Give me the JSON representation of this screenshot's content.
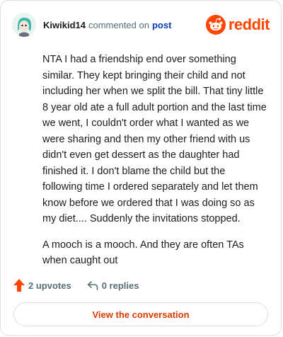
{
  "header": {
    "username": "Kiwikid14",
    "commented_text": "commented on",
    "post_link": "post",
    "brand": "reddit"
  },
  "comment": {
    "paragraphs": [
      "NTA I had a friendship end over something similar. They kept bringing their child and not including her when we split the bill. That tiny little 8 year old ate a full adult portion and the last time we went, I couldn't order what I wanted as we were sharing and then my other friend with us didn't even get dessert as the daughter had finished it. I don't blame the child but the following time I ordered separately and let them know before we ordered that I was doing so as my diet.... Suddenly the invitations stopped.",
      "A mooch is a mooch. And they are often TAs when caught out"
    ]
  },
  "actions": {
    "upvotes": "2 upvotes",
    "replies": "0 replies"
  },
  "footer": {
    "view_label": "View the conversation"
  },
  "colors": {
    "brand": "#ff4500",
    "upvote": "#ff4500",
    "link": "#0a3cb0",
    "view": "#d93a00"
  },
  "icons": [
    "avatar",
    "reddit-snoo-icon",
    "upvote-arrow-icon",
    "reply-icon"
  ]
}
